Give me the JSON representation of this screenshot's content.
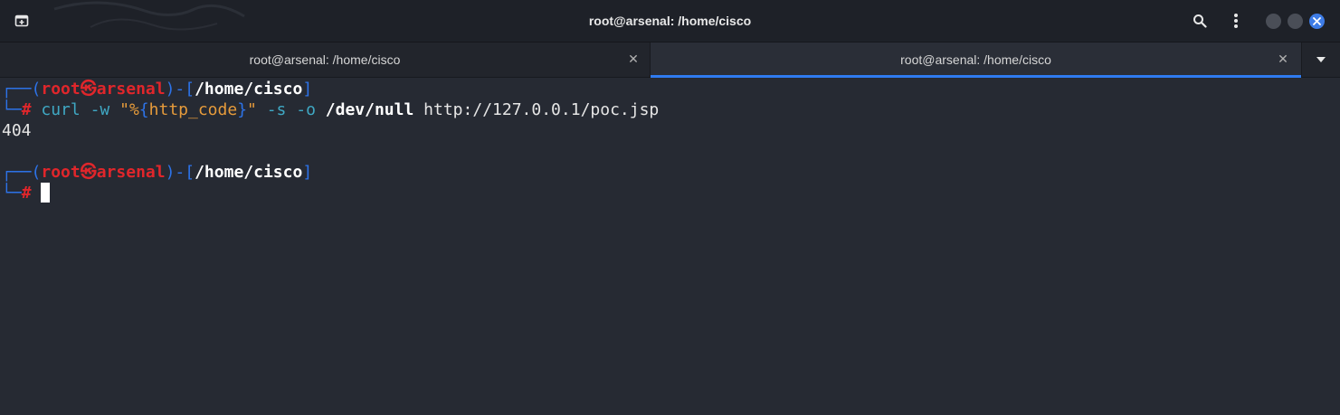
{
  "window": {
    "title": "root@arsenal: /home/cisco"
  },
  "tabs": [
    {
      "label": "root@arsenal: /home/cisco",
      "active": false
    },
    {
      "label": "root@arsenal: /home/cisco",
      "active": true
    }
  ],
  "icons": {
    "new_tab": "new-tab-icon",
    "search": "search-icon",
    "menu": "kebab-menu-icon",
    "close": "close-icon",
    "dropdown": "chevron-down-icon"
  },
  "colors": {
    "accent": "#2f7bf0",
    "prompt_red": "#e0262b",
    "prompt_blue": "#2d73e8",
    "command_cyan": "#3fa8c4",
    "string_orange": "#e69b3b",
    "background": "#262a33"
  },
  "terminal": {
    "prompt1": {
      "corner_top": "┌──(",
      "user": "root",
      "at_symbol": "㉿",
      "host": "arsenal",
      "mid": ")-[",
      "cwd": "/home/cisco",
      "close": "]",
      "corner_bottom": "└─",
      "hash": "#"
    },
    "command": {
      "cmd": "curl",
      "flag_w": "-w",
      "quote_open": "\"%",
      "brace_open": "{",
      "var": "http_code",
      "brace_close": "}",
      "quote_close": "\"",
      "flag_s": "-s",
      "flag_o": "-o",
      "devnull": "/dev/null",
      "url": "http://127.0.0.1/poc.jsp"
    },
    "output": "404",
    "prompt2": {
      "corner_top": "┌──(",
      "user": "root",
      "at_symbol": "㉿",
      "host": "arsenal",
      "mid": ")-[",
      "cwd": "/home/cisco",
      "close": "]",
      "corner_bottom": "└─",
      "hash": "#"
    }
  }
}
